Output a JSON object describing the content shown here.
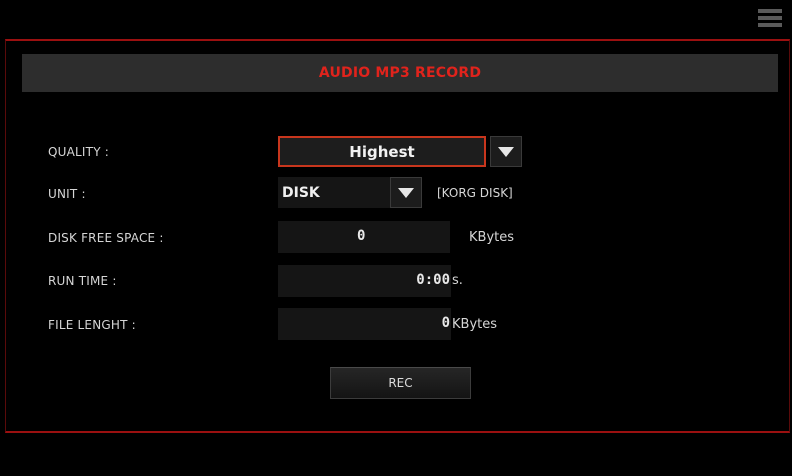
{
  "menu": {
    "icon": "hamburger-menu-icon"
  },
  "title": "AUDIO MP3 RECORD",
  "colors": {
    "accent": "#e0231c",
    "frame": "#9b1010",
    "panel": "#2d2d2d"
  },
  "rows": {
    "quality": {
      "label": "QUALITY :",
      "value": "Highest"
    },
    "unit": {
      "label": "UNIT :",
      "value": "DISK",
      "device": "[KORG DISK]"
    },
    "disk_free_space": {
      "label": "DISK FREE SPACE :",
      "value": "0",
      "unit": "KBytes"
    },
    "run_time": {
      "label": "RUN TIME :",
      "value": "0:00",
      "unit": "s."
    },
    "file_length": {
      "label": "FILE LENGHT :",
      "value": "0",
      "unit": "KBytes"
    }
  },
  "rec_button": {
    "label": "REC"
  }
}
